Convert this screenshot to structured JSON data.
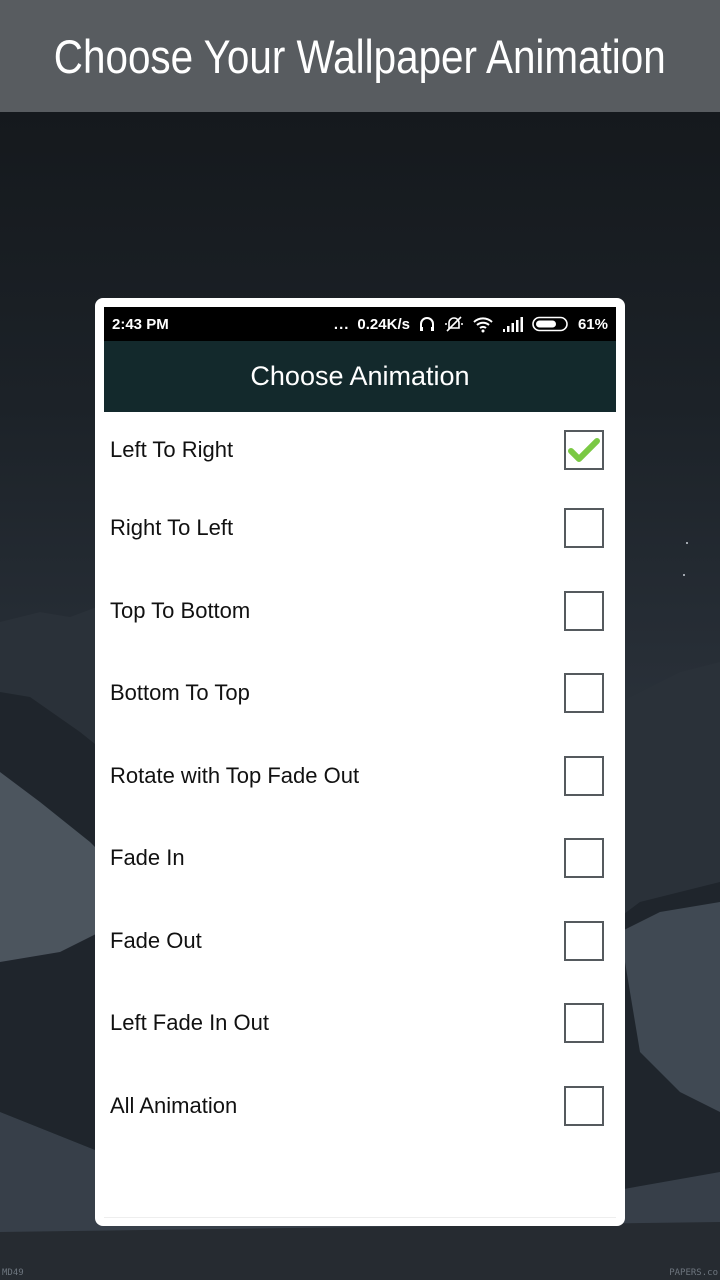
{
  "banner": {
    "title": "Choose Your Wallpaper Animation"
  },
  "status_bar": {
    "time": "2:43 PM",
    "more": "...",
    "network_speed": "0.24K/s",
    "battery_percent": "61%",
    "icons": [
      "headphones-icon",
      "notifications-muted-icon",
      "wifi-icon",
      "signal-icon",
      "battery-icon"
    ]
  },
  "dialog": {
    "title": "Choose Animation",
    "options": [
      {
        "label": "Left To Right",
        "checked": true
      },
      {
        "label": "Right To Left",
        "checked": false
      },
      {
        "label": "Top To Bottom",
        "checked": false
      },
      {
        "label": "Bottom To Top",
        "checked": false
      },
      {
        "label": "Rotate with Top Fade Out",
        "checked": false
      },
      {
        "label": "Fade In",
        "checked": false
      },
      {
        "label": "Fade Out",
        "checked": false
      },
      {
        "label": "Left Fade In Out",
        "checked": false
      },
      {
        "label": "All Animation",
        "checked": false
      }
    ]
  },
  "wallpaper": {
    "watermark_left": "MD49",
    "watermark_right": "PAPERS.co"
  },
  "colors": {
    "banner_bg": "#585c60",
    "app_bar_bg": "#13292c",
    "check_green": "#7ac943"
  }
}
